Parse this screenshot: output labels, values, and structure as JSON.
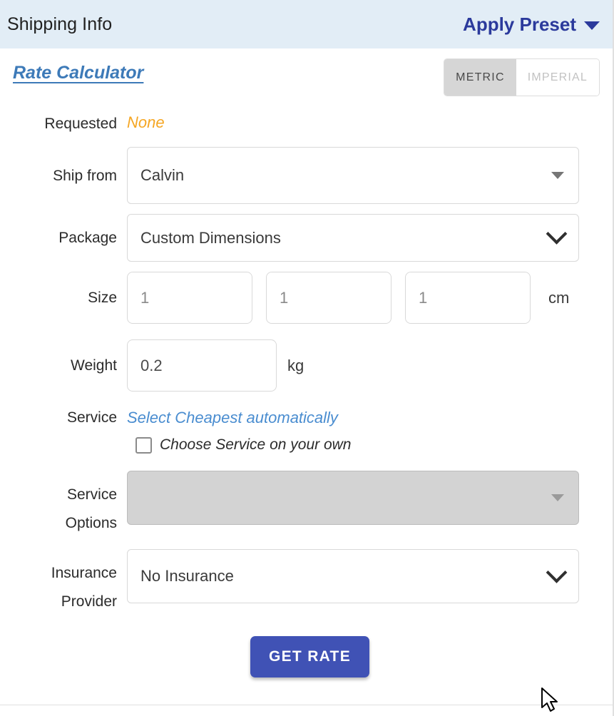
{
  "header": {
    "title": "Shipping Info",
    "apply_preset_label": "Apply Preset",
    "apply_preset_icon": "chevron-down-icon",
    "background_color": "#e2edf6",
    "link_color": "#2b3a9c"
  },
  "panel": {
    "section_link": "Rate Calculator",
    "section_link_color": "#3d7ab8",
    "unit_toggle": {
      "options": [
        "METRIC",
        "IMPERIAL"
      ],
      "selected": "METRIC",
      "metric_label": "METRIC",
      "imperial_label": "IMPERIAL"
    }
  },
  "form": {
    "requested": {
      "label": "Requested",
      "value": "None",
      "value_color": "#f5a623"
    },
    "ship_from": {
      "label": "Ship from",
      "value": "Calvin",
      "icon": "triangle-down-icon"
    },
    "package": {
      "label": "Package",
      "value": "Custom Dimensions",
      "icon": "chevron-down-icon"
    },
    "size": {
      "label": "Size",
      "length": "1",
      "width": "1",
      "height": "1",
      "unit": "cm"
    },
    "weight": {
      "label": "Weight",
      "value": "0.2",
      "unit": "kg"
    },
    "service": {
      "label": "Service",
      "auto_text": "Select Cheapest automatically",
      "auto_text_color": "#4a8dd0",
      "checkbox_label": "Choose Service on your own",
      "checkbox_checked": false
    },
    "service_options": {
      "label_line1": "Service",
      "label_line2": "Options",
      "value": "",
      "disabled": true,
      "icon": "triangle-down-icon"
    },
    "insurance_provider": {
      "label_line1": "Insurance",
      "label_line2": "Provider",
      "value": "No Insurance",
      "icon": "chevron-down-icon"
    },
    "get_rate_button": {
      "label": "GET RATE",
      "color": "#4052b5"
    }
  }
}
